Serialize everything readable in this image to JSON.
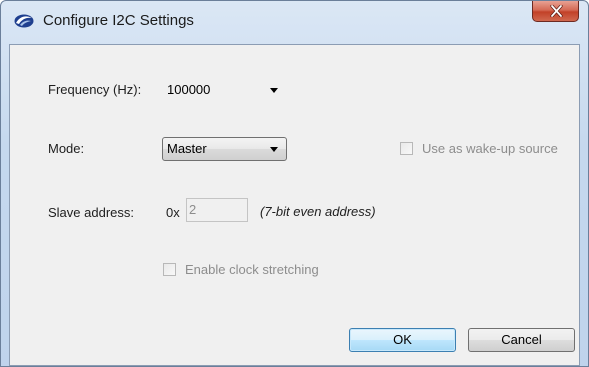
{
  "window": {
    "title": "Configure I2C Settings"
  },
  "frequency": {
    "label": "Frequency (Hz):",
    "value": "100000"
  },
  "mode": {
    "label": "Mode:",
    "value": "Master"
  },
  "wake_up": {
    "label": "Use as wake-up source",
    "checked": false,
    "enabled": false
  },
  "slave_address": {
    "label": "Slave address:",
    "prefix": "0x",
    "value": "2",
    "hint": "(7-bit even address)"
  },
  "clock_stretching": {
    "label": "Enable clock stretching",
    "checked": false,
    "enabled": false
  },
  "buttons": {
    "ok": "OK",
    "cancel": "Cancel"
  },
  "colors": {
    "close_button": "#c24128",
    "default_button_border": "#3c7fb1",
    "disabled_text": "#8d8d8d"
  }
}
